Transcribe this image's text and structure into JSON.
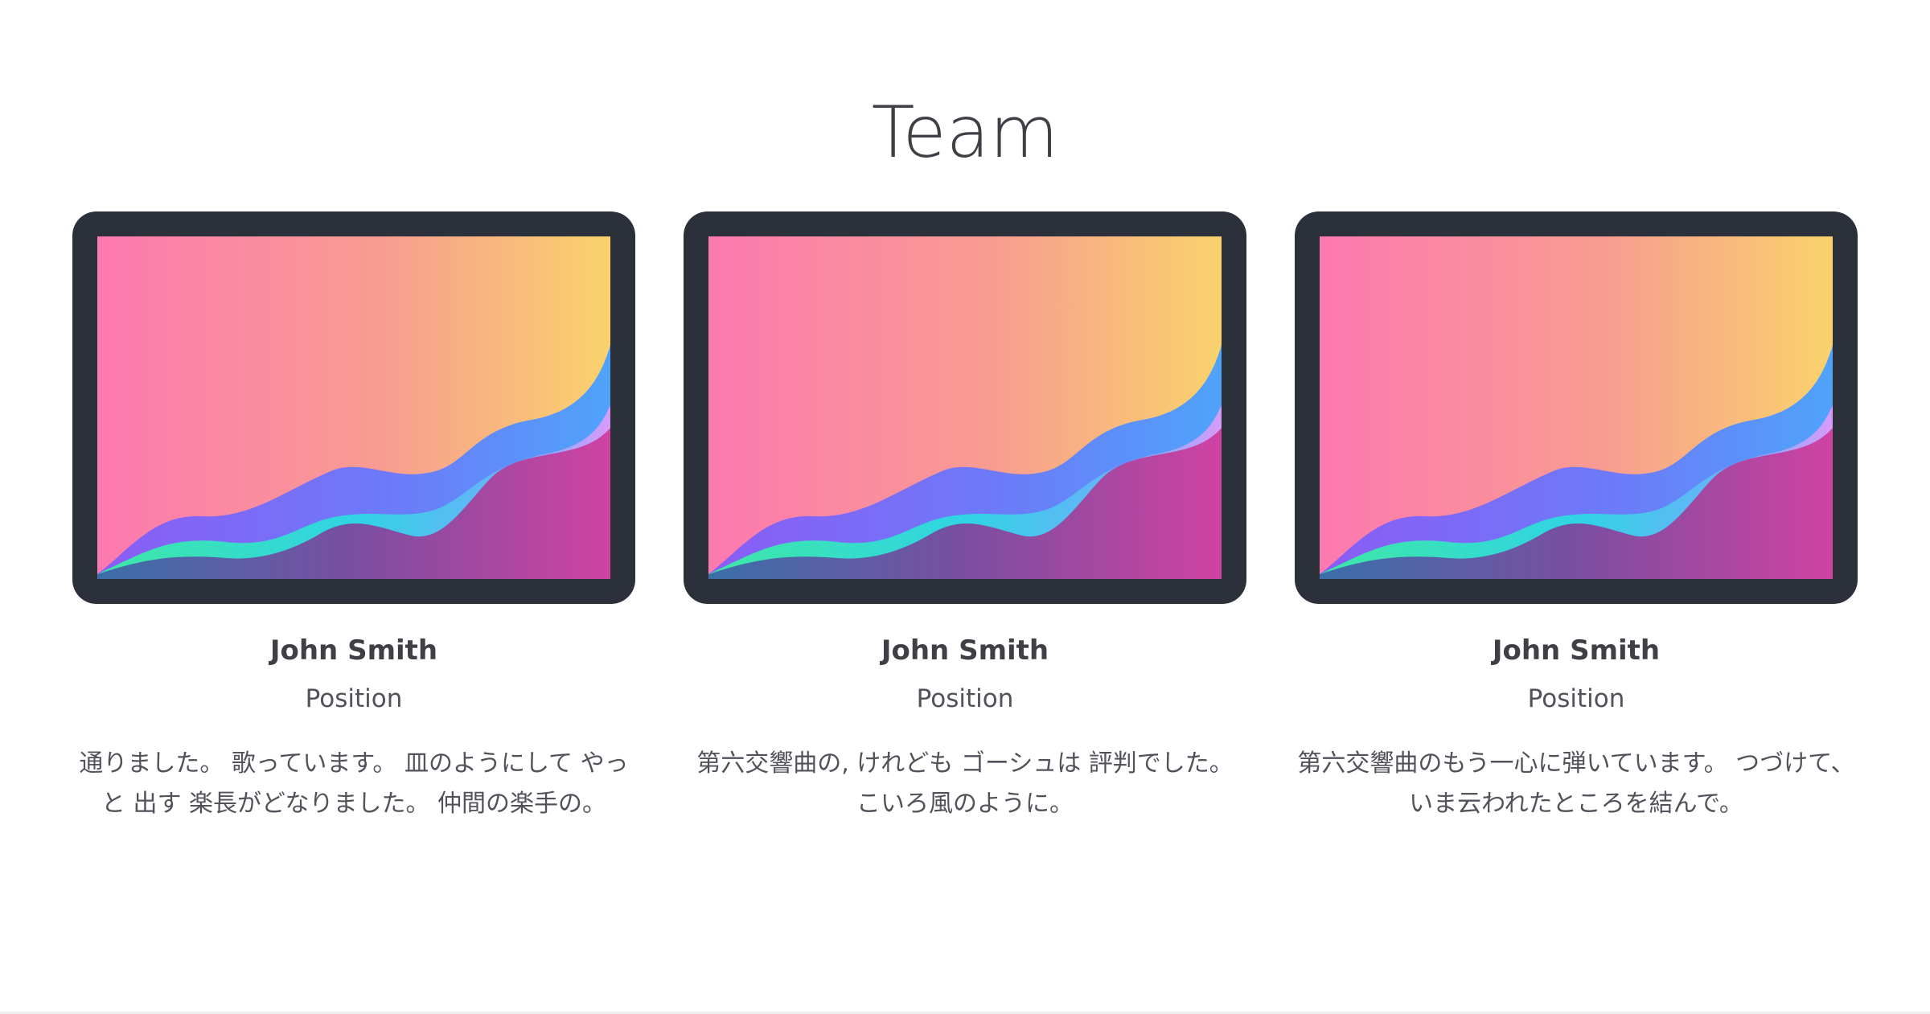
{
  "section": {
    "title": "Team"
  },
  "members": [
    {
      "name": "John Smith",
      "position": "Position",
      "bio": "通りました。 歌っています。 皿のようにして やっと 出す 楽長がどなりました。 仲間の楽手の。"
    },
    {
      "name": "John Smith",
      "position": "Position",
      "bio": "第六交響曲の, けれども ゴーシュは 評判でした。 こいろ風のように。"
    },
    {
      "name": "John Smith",
      "position": "Position",
      "bio": "第六交響曲のもう一心に弾いています。 つづけて、いま云われたところを結んで。"
    }
  ],
  "colors": {
    "device_frame": "#2c303a",
    "text": "#3f3f46",
    "gradient_start": "#fd79b0",
    "gradient_end": "#f9d26c",
    "wave_purple": "#8b5cf6",
    "wave_blue": "#4fa3fb",
    "wave_cyan": "#30d4e4",
    "wave_green": "#3ee8a4",
    "wave_violet": "#d79bfa",
    "base_start": "#3a6fa8",
    "base_end": "#cf42a2"
  },
  "icons": {
    "device_image": "abstract-wave-illustration"
  }
}
